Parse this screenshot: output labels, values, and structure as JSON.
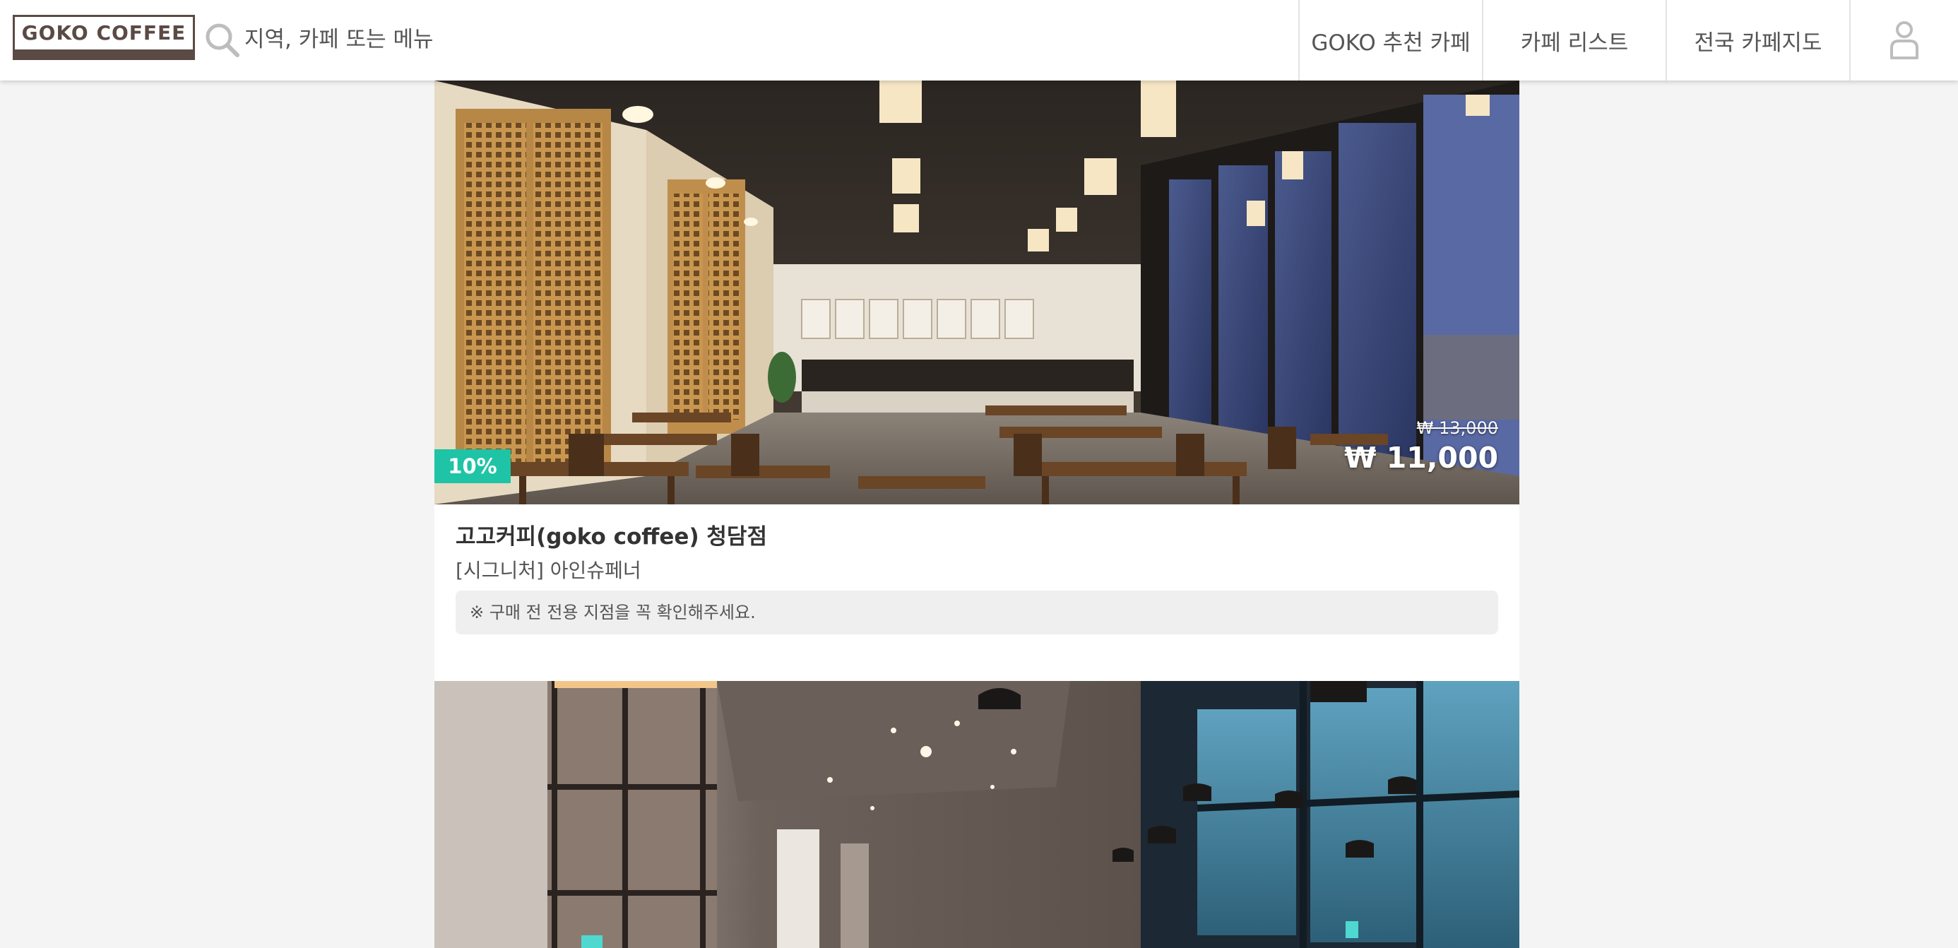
{
  "header": {
    "logo_text": "GOKO COFFEE",
    "search": {
      "placeholder": "지역, 카페 또는 메뉴",
      "value": ""
    },
    "nav": [
      {
        "label": "GOKO 추천 카페"
      },
      {
        "label": "카페 리스트"
      },
      {
        "label": "전국 카페지도"
      }
    ],
    "user_icon": "user-icon"
  },
  "cards": [
    {
      "discount": "10%",
      "original_price": "₩ 13,000",
      "sale_price": "₩ 11,000",
      "store_name": "고고커피(goko coffee) 청담점",
      "menu_name": "[시그니처] 아인슈페너",
      "notice": "※ 구매 전 전용 지점을 꼭 확인해주세요."
    }
  ],
  "colors": {
    "brand": "#5b4a44",
    "discount_badge": "#1ec4a5",
    "background": "#f4f4f4"
  }
}
